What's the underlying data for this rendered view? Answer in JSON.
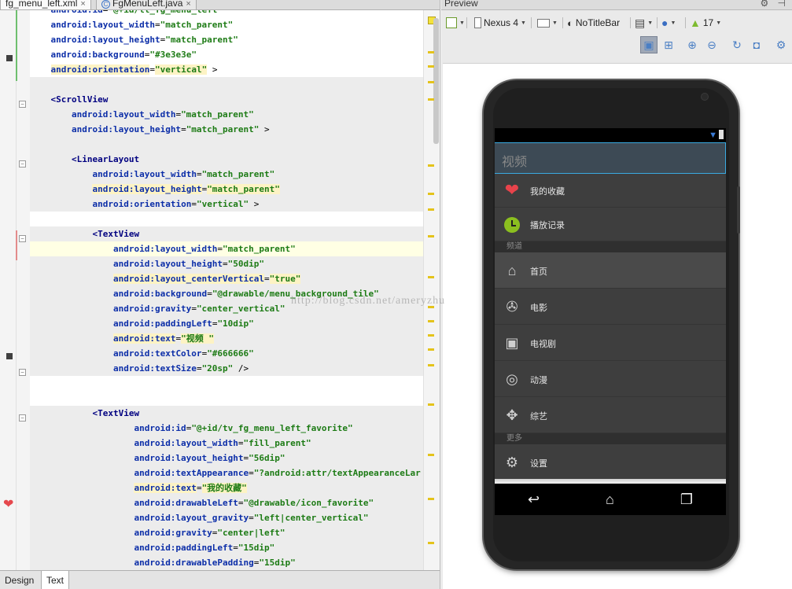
{
  "tabs": {
    "left_tab": "fg_menu_left.xml",
    "right_tab": "FgMenuLeft.java",
    "close_glyph": "×"
  },
  "code_lines": [
    {
      "indent": "    ",
      "attr": "android:id",
      "value": "\"@+id/ll_fg_menu_left\"",
      "tail": ""
    },
    {
      "indent": "    ",
      "attr": "android:layout_width",
      "value": "\"match_parent\"",
      "tail": ""
    },
    {
      "indent": "    ",
      "attr": "android:layout_height",
      "value": "\"match_parent\"",
      "tail": ""
    },
    {
      "indent": "    ",
      "attr": "android:background",
      "value": "\"#3e3e3e\"",
      "tail": ""
    },
    {
      "indent": "    ",
      "attr": "android:orientation",
      "value": "\"vertical\"",
      "tail": " >"
    },
    {
      "indent": "",
      "attr": "",
      "value": "",
      "tail": ""
    },
    {
      "indent": "    ",
      "tag": "<ScrollView",
      "attr": "",
      "value": "",
      "tail": ""
    },
    {
      "indent": "        ",
      "attr": "android:layout_width",
      "value": "\"match_parent\"",
      "tail": ""
    },
    {
      "indent": "        ",
      "attr": "android:layout_height",
      "value": "\"match_parent\"",
      "tail": " >"
    },
    {
      "indent": "",
      "attr": "",
      "value": "",
      "tail": ""
    },
    {
      "indent": "        ",
      "tag": "<LinearLayout",
      "attr": "",
      "value": "",
      "tail": ""
    },
    {
      "indent": "            ",
      "attr": "android:layout_width",
      "value": "\"match_parent\"",
      "tail": ""
    },
    {
      "indent": "            ",
      "attr": "android:layout_height",
      "value": "\"match_parent\"",
      "tail": ""
    },
    {
      "indent": "            ",
      "attr": "android:orientation",
      "value": "\"vertical\"",
      "tail": " >"
    },
    {
      "indent": "",
      "attr": "",
      "value": "",
      "tail": ""
    },
    {
      "indent": "            ",
      "tag": "<TextView",
      "attr": "",
      "value": "",
      "tail": ""
    },
    {
      "indent": "                ",
      "attr": "android:layout_width",
      "value": "\"match_parent\"",
      "tail": ""
    },
    {
      "indent": "                ",
      "attr": "android:layout_height",
      "value": "\"50dip\"",
      "tail": ""
    },
    {
      "indent": "                ",
      "attr": "android:layout_centerVertical",
      "value": "\"true\"",
      "tail": ""
    },
    {
      "indent": "                ",
      "attr": "android:background",
      "value": "\"@drawable/menu_background_tile\"",
      "tail": ""
    },
    {
      "indent": "                ",
      "attr": "android:gravity",
      "value": "\"center_vertical\"",
      "tail": ""
    },
    {
      "indent": "                ",
      "attr": "android:paddingLeft",
      "value": "\"10dip\"",
      "tail": ""
    },
    {
      "indent": "                ",
      "attr": "android:text",
      "value": "\"视频 \"",
      "tail": ""
    },
    {
      "indent": "                ",
      "attr": "android:textColor",
      "value": "\"#666666\"",
      "tail": ""
    },
    {
      "indent": "                ",
      "attr": "android:textSize",
      "value": "\"20sp\"",
      "tail": " />"
    },
    {
      "indent": "",
      "attr": "",
      "value": "",
      "tail": ""
    },
    {
      "indent": "",
      "attr": "",
      "value": "",
      "tail": ""
    },
    {
      "indent": "            ",
      "tag": "<TextView",
      "attr": "",
      "value": "",
      "tail": ""
    },
    {
      "indent": "                    ",
      "attr": "android:id",
      "value": "\"@+id/tv_fg_menu_left_favorite\"",
      "tail": ""
    },
    {
      "indent": "                    ",
      "attr": "android:layout_width",
      "value": "\"fill_parent\"",
      "tail": ""
    },
    {
      "indent": "                    ",
      "attr": "android:layout_height",
      "value": "\"56dip\"",
      "tail": ""
    },
    {
      "indent": "                    ",
      "attr": "android:textAppearance",
      "value": "\"?android:attr/textAppearanceLar",
      "tail": ""
    },
    {
      "indent": "                    ",
      "attr": "android:text",
      "value": "\"我的收藏\"",
      "tail": ""
    },
    {
      "indent": "                    ",
      "attr": "android:drawableLeft",
      "value": "\"@drawable/icon_favorite\"",
      "tail": ""
    },
    {
      "indent": "                    ",
      "attr": "android:layout_gravity",
      "value": "\"left|center_vertical\"",
      "tail": ""
    },
    {
      "indent": "                    ",
      "attr": "android:gravity",
      "value": "\"center|left\"",
      "tail": ""
    },
    {
      "indent": "                    ",
      "attr": "android:paddingLeft",
      "value": "\"15dip\"",
      "tail": ""
    },
    {
      "indent": "                    ",
      "attr": "android:drawablePadding",
      "value": "\"15dip\"",
      "tail": ""
    }
  ],
  "editor_bottom_tabs": {
    "design": "Design",
    "text": "Text"
  },
  "preview": {
    "panel_title": "Preview",
    "header_icons": "⚙ ⊣",
    "device": "Nexus 4",
    "theme": "NoTitleBar",
    "api_level": "17",
    "icons": {
      "palette": "palette-icon",
      "device": "phone-icon",
      "orientation": "rotate-icon",
      "theme": "theme-icon",
      "layout": "layout-icon",
      "locale": "globe-icon",
      "api": "android-icon",
      "zoom_fit": "zoom-fit-icon",
      "zoom_actual": "zoom-actual-icon",
      "zoom_in": "zoom-in-icon",
      "zoom_out": "zoom-out-icon",
      "refresh": "refresh-icon",
      "screenshot": "camera-icon",
      "settings": "gear-icon"
    },
    "glyphs": {
      "zoom_in": "⊕",
      "zoom_out": "⊖",
      "zoom_actual": "⊞",
      "zoom_fit": "▣",
      "refresh": "↻",
      "screenshot": "◘",
      "settings": "⚙"
    }
  },
  "app": {
    "header_title": "视频",
    "section_channels": "频道",
    "section_more": "更多",
    "items": [
      {
        "label": "我的收藏",
        "icon": "heart-icon",
        "glyph": "❤"
      },
      {
        "label": "播放记录",
        "icon": "clock-icon",
        "glyph": ""
      },
      {
        "label": "首页",
        "icon": "home-icon",
        "glyph": "⌂"
      },
      {
        "label": "电影",
        "icon": "film-reel-icon",
        "glyph": "✇"
      },
      {
        "label": "电视剧",
        "icon": "tv-icon",
        "glyph": "▣"
      },
      {
        "label": "动漫",
        "icon": "spiral-icon",
        "glyph": "◎"
      },
      {
        "label": "综艺",
        "icon": "camera-icon",
        "glyph": "✥"
      },
      {
        "label": "设置",
        "icon": "gear-icon",
        "glyph": "⚙"
      }
    ],
    "nav": {
      "back": "↩",
      "home": "⌂",
      "recents": "❐"
    }
  },
  "watermark": "http://blog.csdn.net/ameryzhu",
  "colors": {
    "menu_bg": "#3e3e3e",
    "header_border": "#3aa9e0",
    "favorite_red": "#e8434b",
    "history_green": "#8bbf1f",
    "code_attr": "#0c2ea8",
    "code_value": "#1d7b15"
  }
}
